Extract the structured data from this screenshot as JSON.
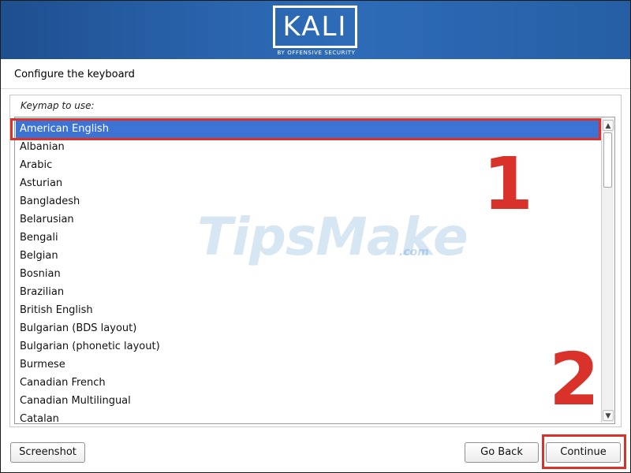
{
  "header": {
    "logo_text": "KALI",
    "logo_subtitle": "BY OFFENSIVE SECURITY"
  },
  "page_title": "Configure the keyboard",
  "keymap": {
    "label": "Keymap to use:",
    "selected": "American English",
    "items": [
      "American English",
      "Albanian",
      "Arabic",
      "Asturian",
      "Bangladesh",
      "Belarusian",
      "Bengali",
      "Belgian",
      "Bosnian",
      "Brazilian",
      "British English",
      "Bulgarian (BDS layout)",
      "Bulgarian (phonetic layout)",
      "Burmese",
      "Canadian French",
      "Canadian Multilingual",
      "Catalan"
    ]
  },
  "scrollbar": {
    "up_icon": "▲",
    "down_icon": "▼"
  },
  "watermark": {
    "text": "TipsMake",
    "suffix": ".com"
  },
  "annotations": {
    "step1": "1",
    "step2": "2"
  },
  "buttons": {
    "screenshot": "Screenshot",
    "go_back": "Go Back",
    "continue": "Continue"
  },
  "colors": {
    "banner": "#2a64ad",
    "selection": "#3d73d2",
    "annotation": "#d9322a"
  }
}
